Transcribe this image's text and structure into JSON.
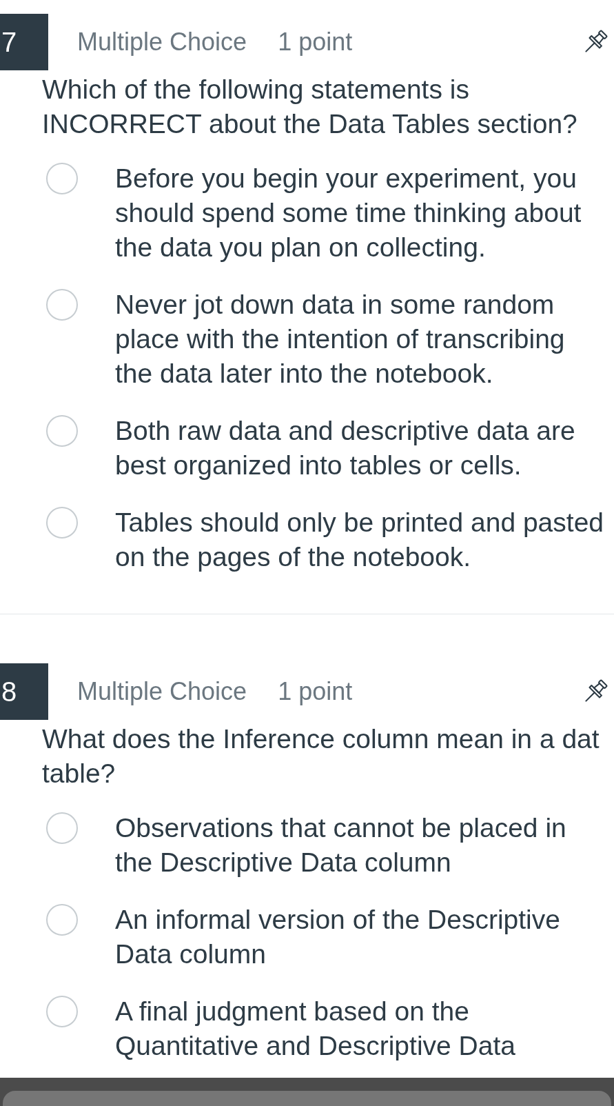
{
  "questions": [
    {
      "number": "7",
      "type": "Multiple Choice",
      "points": "1 point",
      "text": "Which of the following statements is INCORRECT about the Data Tables section?",
      "options": [
        {
          "text": "Before you begin your experiment, you should spend some time thinking about the data you plan on collecting.",
          "selected": false
        },
        {
          "text": "Never jot down data in some random place with the intention of transcribing the data later into the notebook.",
          "selected": false
        },
        {
          "text": "Both raw data and descriptive data are best organized into tables or cells.",
          "selected": false
        },
        {
          "text": "Tables should only be printed and pasted on the pages of the notebook.",
          "selected": false
        }
      ]
    },
    {
      "number": "8",
      "type": "Multiple Choice",
      "points": "1 point",
      "text": "What does the Inference column mean in a dat table?",
      "options": [
        {
          "text": "Observations that cannot be placed in the Descriptive Data column",
          "selected": false
        },
        {
          "text": "An informal version of the Descriptive Data column",
          "selected": false
        },
        {
          "text": "A final judgment based on the Quantitative and Descriptive Data",
          "selected": false
        }
      ]
    }
  ]
}
